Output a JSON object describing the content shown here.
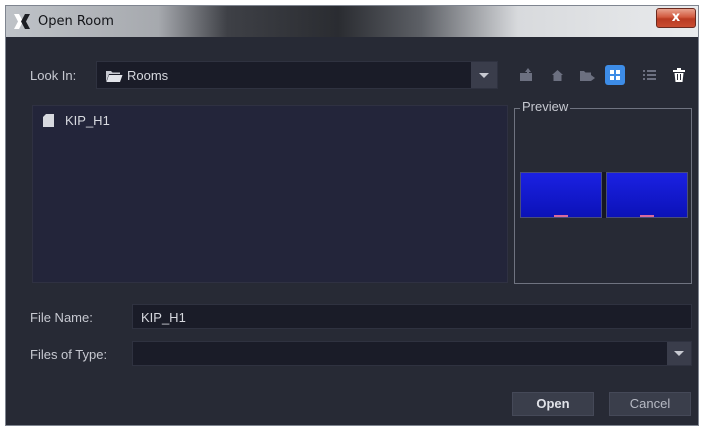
{
  "window": {
    "title": "Open Room",
    "close_label": "x",
    "colors": {
      "background": "#272a35",
      "field": "#1a1c28",
      "accent": "#3d8ce6"
    }
  },
  "lookin": {
    "label": "Look In:",
    "value": "Rooms",
    "icon": "folder-open-icon"
  },
  "toolbar": {
    "icons": [
      "up-folder-icon",
      "home-icon",
      "new-folder-icon",
      "grid-view-icon",
      "list-view-icon",
      "trash-icon"
    ],
    "active": "grid-view-icon"
  },
  "file_list": {
    "items": [
      {
        "name": "KIP_H1",
        "icon": "file-icon"
      }
    ]
  },
  "preview": {
    "legend": "Preview"
  },
  "file_name": {
    "label": "File Name:",
    "value": "KIP_H1"
  },
  "file_type": {
    "label": "Files of Type:",
    "value": ""
  },
  "buttons": {
    "open": "Open",
    "cancel": "Cancel"
  }
}
